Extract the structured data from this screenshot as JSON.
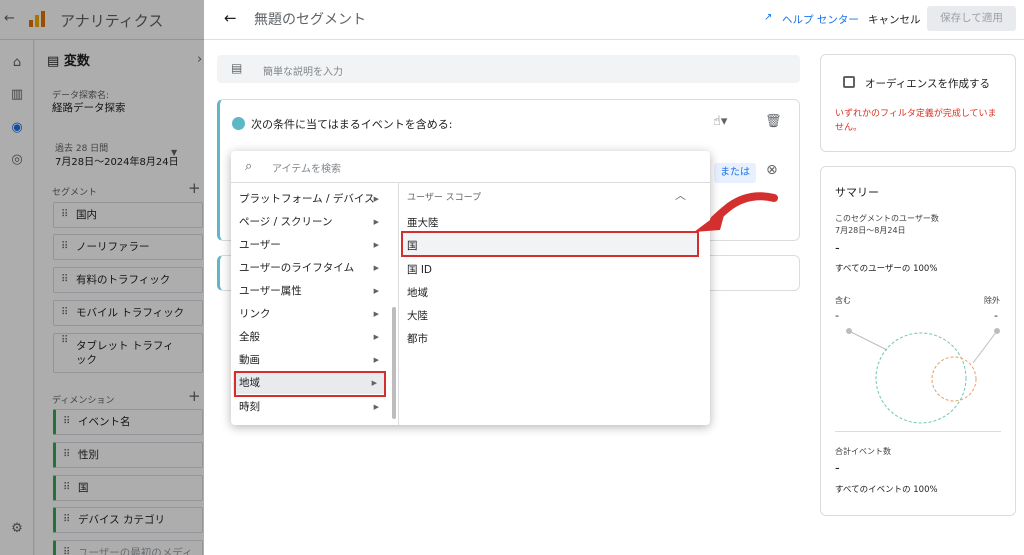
{
  "app": {
    "title": "アナリティクス"
  },
  "variables": {
    "header": "変数",
    "exploration_label": "データ探索名:",
    "exploration_name": "経路データ探索",
    "date_label": "過去 28 日間",
    "date_range": "7月28日～2024年8月24日",
    "segments_label": "セグメント",
    "segments": [
      "国内",
      "ノーリファラー",
      "有料のトラフィック",
      "モバイル トラフィック",
      "タブレット トラフィック"
    ],
    "dimensions_label": "ディメンション",
    "dimensions": [
      "イベント名",
      "性別",
      "国",
      "デバイス カテゴリ",
      "ユーザーの最初のメディア"
    ]
  },
  "segment_editor": {
    "title": "無題のセグメント",
    "help": "ヘルプ センター",
    "cancel": "キャンセル",
    "save": "保存して適用",
    "description_placeholder": "簡単な説明を入力",
    "condition_header": "次の条件に当てはまるイベントを含める:",
    "or_label": "または"
  },
  "dropdown": {
    "search_placeholder": "アイテムを検索",
    "categories": [
      "プラットフォーム / デバイス",
      "ページ / スクリーン",
      "ユーザー",
      "ユーザーのライフタイム",
      "ユーザー属性",
      "リンク",
      "全般",
      "動画",
      "地域",
      "時刻"
    ],
    "selected_category": "地域",
    "scope_label": "ユーザー スコープ",
    "items": [
      "亜大陸",
      "国",
      "国 ID",
      "地域",
      "大陸",
      "都市"
    ],
    "highlighted_item": "国"
  },
  "audience": {
    "checkbox_label": "オーディエンスを作成する",
    "warning": "いずれかのフィルタ定義が完成していません。"
  },
  "summary": {
    "title": "サマリー",
    "users_label": "このセグメントのユーザー数",
    "users_date": "7月28日～8月24日",
    "users_value": "-",
    "users_pct": "すべてのユーザーの 100%",
    "include_label": "含む",
    "include_value": "-",
    "exclude_label": "除外",
    "exclude_value": "-",
    "events_label": "合計イベント数",
    "events_value": "-",
    "events_pct": "すべてのイベントの 100%"
  },
  "colors": {
    "accent": "#1a73e8",
    "highlight": "#d32f2f",
    "condition_accent": "#5bb8c4"
  }
}
